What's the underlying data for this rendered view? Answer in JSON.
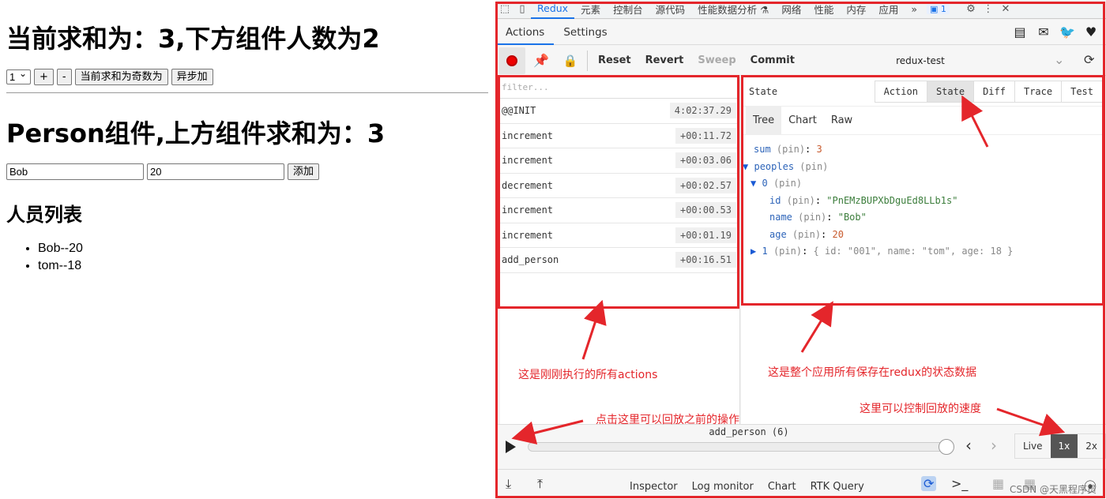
{
  "app": {
    "title1": "当前求和为：3,下方组件人数为2",
    "select_value": "1",
    "btn_plus": "+",
    "btn_minus": "-",
    "btn_odd": "当前求和为奇数为",
    "btn_async": "异步加",
    "title2": "Person组件,上方组件求和为：3",
    "name_value": "Bob",
    "age_value": "20",
    "btn_add": "添加",
    "list_title": "人员列表",
    "people": [
      "Bob--20",
      "tom--18"
    ]
  },
  "devtools": {
    "tabs": [
      "Redux",
      "元素",
      "控制台",
      "源代码",
      "性能数据分析 ⚗",
      "网络",
      "性能",
      "内存",
      "应用"
    ],
    "more": "»",
    "badge": "1",
    "redux_tabs": [
      "Actions",
      "Settings"
    ],
    "toolbar": {
      "reset": "Reset",
      "revert": "Revert",
      "sweep": "Sweep",
      "commit": "Commit",
      "instance": "redux-test"
    },
    "filter_placeholder": "filter...",
    "actions": [
      {
        "name": "@@INIT",
        "time": "4:02:37.29"
      },
      {
        "name": "increment",
        "time": "+00:11.72"
      },
      {
        "name": "increment",
        "time": "+00:03.06"
      },
      {
        "name": "decrement",
        "time": "+00:02.57"
      },
      {
        "name": "increment",
        "time": "+00:00.53"
      },
      {
        "name": "increment",
        "time": "+00:01.19"
      },
      {
        "name": "add_person",
        "time": "+00:16.51"
      }
    ],
    "state_title": "State",
    "inspector_tabs": [
      "Action",
      "State",
      "Diff",
      "Trace",
      "Test"
    ],
    "view_tabs": [
      "Tree",
      "Chart",
      "Raw"
    ],
    "tree": {
      "sum_key": "sum",
      "sum_val": "3",
      "peoples_key": "peoples",
      "pin": "(pin)",
      "item0_key": "0",
      "id_key": "id",
      "id_val": "\"PnEMzBUPXbDguEd8LLb1s\"",
      "name_key": "name",
      "name_val": "\"Bob\"",
      "age_key": "age",
      "age_val": "20",
      "item1_key": "1",
      "item1_val": "{ id: \"001\", name: \"tom\", age: 18 }"
    },
    "current_action": "add_person (6)",
    "speed": [
      "Live",
      "1x",
      "2x"
    ],
    "monitors": [
      "Inspector",
      "Log monitor",
      "Chart",
      "RTK Query"
    ]
  },
  "annotations": {
    "actions_note": "这是刚刚执行的所有actions",
    "state_note": "这是整个应用所有保存在redux的状态数据",
    "replay_note": "点击这里可以回放之前的操作",
    "speed_note": "这里可以控制回放的速度",
    "watermark": "CSDN @天黑程序员"
  },
  "colors": {
    "annotation": "#e4262b",
    "accent": "#1a73e8"
  }
}
